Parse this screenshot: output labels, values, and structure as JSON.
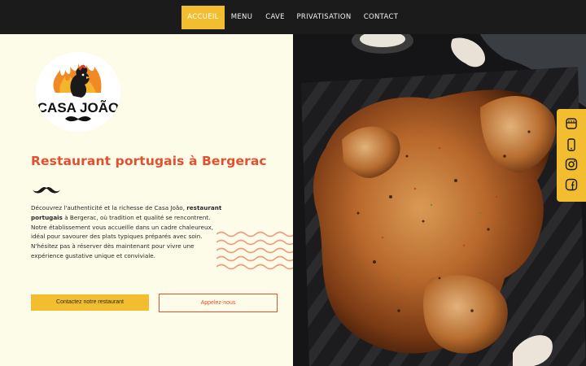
{
  "nav": {
    "items": [
      {
        "label": "ACCUEIL",
        "active": true
      },
      {
        "label": "MENU",
        "active": false
      },
      {
        "label": "CAVE",
        "active": false
      },
      {
        "label": "PRIVATISATION",
        "active": false
      },
      {
        "label": "CONTACT",
        "active": false
      }
    ]
  },
  "logo": {
    "text_line1": "CASA",
    "text_line2": "JOÃO"
  },
  "intro": {
    "title": "Restaurant portugais à Bergerac",
    "paragraph1_before": "Découvrez l'authenticité et la richesse de Casa João, ",
    "paragraph1_bold": "restaurant portugais",
    "paragraph1_after": " à Bergerac, où tradition et qualité se rencontrent.",
    "paragraph2": "Notre établissement vous accueille dans un cadre chaleureux, idéal pour savourer des plats typiques préparés avec soin.",
    "paragraph3": "N'hésitez pas à réserver dès maintenant pour vivre une expérience gustative unique et conviviale."
  },
  "buttons": {
    "contact": "Contactez notre restaurant",
    "call": "Appelez-nous"
  },
  "social_icons": [
    "storefront-icon",
    "phone-icon",
    "instagram-icon",
    "facebook-icon"
  ],
  "colors": {
    "accent_yellow": "#f2bd2e",
    "accent_red": "#e4502f",
    "nav_background": "#1b1b1b",
    "page_background": "#fdfce9"
  }
}
